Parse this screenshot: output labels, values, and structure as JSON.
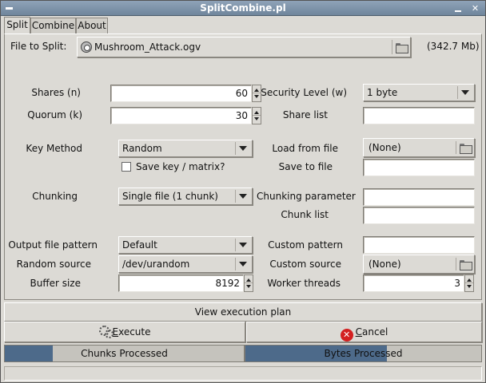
{
  "window": {
    "title": "SplitCombine.pl"
  },
  "tabs": [
    {
      "label": "Split",
      "active": true
    },
    {
      "label": "Combine",
      "active": false
    },
    {
      "label": "About",
      "active": false
    }
  ],
  "file": {
    "label": "File to Split:",
    "value": "Mushroom_Attack.ogv",
    "size": "(342.7 Mb)"
  },
  "left": {
    "shares_label": "Shares (n)",
    "shares_value": "60",
    "quorum_label": "Quorum (k)",
    "quorum_value": "30",
    "key_method_label": "Key Method",
    "key_method_value": "Random",
    "save_key_label": "Save key / matrix?",
    "chunking_label": "Chunking",
    "chunking_value": "Single file (1 chunk)",
    "output_pattern_label": "Output file pattern",
    "output_pattern_value": "Default",
    "random_source_label": "Random source",
    "random_source_value": "/dev/urandom",
    "buffer_size_label": "Buffer size",
    "buffer_size_value": "8192"
  },
  "right": {
    "security_level_label": "Security Level (w)",
    "security_level_value": "1 byte",
    "share_list_label": "Share list",
    "load_from_file_label": "Load from file",
    "load_from_file_value": "(None)",
    "save_to_file_label": "Save to file",
    "chunking_parameter_label": "Chunking parameter",
    "chunk_list_label": "Chunk list",
    "custom_pattern_label": "Custom pattern",
    "custom_source_label": "Custom source",
    "custom_source_value": "(None)",
    "worker_threads_label": "Worker threads",
    "worker_threads_value": "3"
  },
  "actions": {
    "view_plan": "View execution plan",
    "execute_prefix": "",
    "execute_mnemonic": "E",
    "execute_rest": "xecute",
    "cancel_mnemonic": "C",
    "cancel_rest": "ancel"
  },
  "progress": {
    "chunks_label": "Chunks Processed",
    "chunks_fraction": 0.2,
    "bytes_label": "Bytes Processed",
    "bytes_fraction": 0.6
  },
  "colors": {
    "titlebar": "#7b90a6",
    "progress_fill": "#4d6a8a",
    "cancel_icon": "#d32020"
  }
}
